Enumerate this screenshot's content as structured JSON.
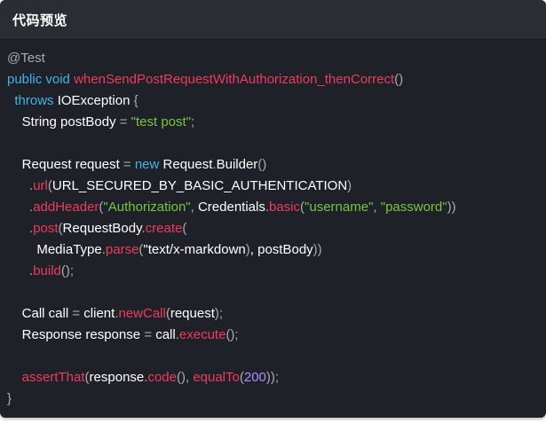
{
  "header": {
    "title": "代码预览"
  },
  "colors": {
    "background": "#1e2127",
    "header_background": "#2a2d33",
    "keyword": "#3fb6e8",
    "method": "#ef3b5f",
    "string": "#7cc53f",
    "number": "#b58cff",
    "punctuation": "#a9abaf",
    "plain": "#ffffff"
  },
  "code": {
    "language": "java",
    "lines": [
      [
        [
          "annotation",
          "@Test"
        ]
      ],
      [
        [
          "keyword",
          "public"
        ],
        [
          "plain",
          " "
        ],
        [
          "keyword",
          "void"
        ],
        [
          "plain",
          " "
        ],
        [
          "method",
          "whenSendPostRequestWithAuthorization_thenCorrect"
        ],
        [
          "punct",
          "()"
        ]
      ],
      [
        [
          "plain",
          "  "
        ],
        [
          "keyword",
          "throws"
        ],
        [
          "plain",
          " IOException "
        ],
        [
          "punct",
          "{"
        ]
      ],
      [
        [
          "plain",
          "    String postBody "
        ],
        [
          "punct",
          "="
        ],
        [
          "plain",
          " "
        ],
        [
          "string",
          "\"test post\""
        ],
        [
          "punct",
          ";"
        ]
      ],
      [],
      [
        [
          "plain",
          "    Request request "
        ],
        [
          "punct",
          "="
        ],
        [
          "plain",
          " "
        ],
        [
          "keyword",
          "new"
        ],
        [
          "plain",
          " Request"
        ],
        [
          "punct",
          "."
        ],
        [
          "plain",
          "Builder"
        ],
        [
          "punct",
          "()"
        ]
      ],
      [
        [
          "plain",
          "      "
        ],
        [
          "punct",
          "."
        ],
        [
          "method",
          "url"
        ],
        [
          "punct",
          "("
        ],
        [
          "plain",
          "URL_SECURED_BY_BASIC_AUTHENTICATION"
        ],
        [
          "punct",
          ")"
        ]
      ],
      [
        [
          "plain",
          "      "
        ],
        [
          "punct",
          "."
        ],
        [
          "method",
          "addHeader"
        ],
        [
          "punct",
          "("
        ],
        [
          "string",
          "\"Authorization\""
        ],
        [
          "punct",
          ","
        ],
        [
          "plain",
          " Credentials"
        ],
        [
          "punct",
          "."
        ],
        [
          "method",
          "basic"
        ],
        [
          "punct",
          "("
        ],
        [
          "string",
          "\"username\""
        ],
        [
          "punct",
          ","
        ],
        [
          "plain",
          " "
        ],
        [
          "string",
          "\"password\""
        ],
        [
          "punct",
          "))"
        ]
      ],
      [
        [
          "plain",
          "      "
        ],
        [
          "punct",
          "."
        ],
        [
          "method",
          "post"
        ],
        [
          "punct",
          "("
        ],
        [
          "plain",
          "RequestBody"
        ],
        [
          "punct",
          "."
        ],
        [
          "method",
          "create"
        ],
        [
          "punct",
          "("
        ]
      ],
      [
        [
          "plain",
          "        MediaType"
        ],
        [
          "punct",
          "."
        ],
        [
          "method",
          "parse"
        ],
        [
          "punct",
          "("
        ],
        [
          "plain",
          "\"text/x-markdown"
        ],
        [
          "punct",
          ")"
        ],
        [
          "plain",
          ", postBody"
        ],
        [
          "punct",
          "))"
        ]
      ],
      [
        [
          "plain",
          "      "
        ],
        [
          "punct",
          "."
        ],
        [
          "method",
          "build"
        ],
        [
          "punct",
          "();"
        ]
      ],
      [],
      [
        [
          "plain",
          "    Call call "
        ],
        [
          "punct",
          "="
        ],
        [
          "plain",
          " client"
        ],
        [
          "punct",
          "."
        ],
        [
          "method",
          "newCall"
        ],
        [
          "punct",
          "("
        ],
        [
          "plain",
          "request"
        ],
        [
          "punct",
          ");"
        ]
      ],
      [
        [
          "plain",
          "    Response response "
        ],
        [
          "punct",
          "="
        ],
        [
          "plain",
          " call"
        ],
        [
          "punct",
          "."
        ],
        [
          "method",
          "execute"
        ],
        [
          "punct",
          "();"
        ]
      ],
      [],
      [
        [
          "plain",
          "    "
        ],
        [
          "method",
          "assertThat"
        ],
        [
          "punct",
          "("
        ],
        [
          "plain",
          "response"
        ],
        [
          "punct",
          "."
        ],
        [
          "method",
          "code"
        ],
        [
          "punct",
          "(),"
        ],
        [
          "plain",
          " "
        ],
        [
          "method",
          "equalTo"
        ],
        [
          "punct",
          "("
        ],
        [
          "number",
          "200"
        ],
        [
          "punct",
          "));"
        ]
      ],
      [
        [
          "punct",
          "}"
        ]
      ]
    ]
  }
}
